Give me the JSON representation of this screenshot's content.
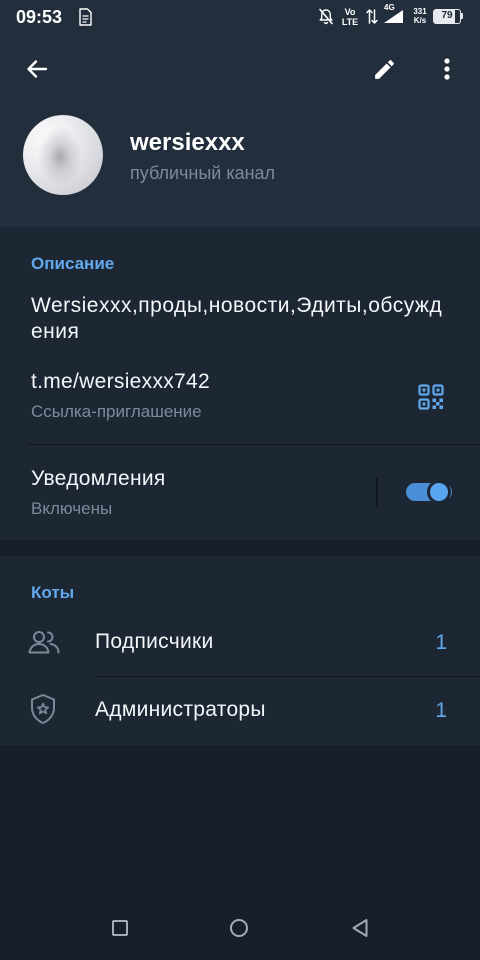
{
  "status_bar": {
    "time": "09:53",
    "volte_top": "Vo",
    "volte_bottom": "LTE",
    "network_type": "4G",
    "speed_value": "331",
    "speed_unit": "K/s",
    "battery_percent": "79"
  },
  "channel": {
    "name": "wersiexxx",
    "type": "публичный канал"
  },
  "info": {
    "description_title": "Описание",
    "description": "Wersiexxx,проды,новости,Эдиты,обсуждения",
    "link": "t.me/wersiexxx742",
    "link_caption": "Ссылка-приглашение",
    "notifications_label": "Уведомления",
    "notifications_status": "Включены",
    "notifications_enabled": true
  },
  "members": {
    "title": "Коты",
    "items": [
      {
        "label": "Подписчики",
        "count": "1",
        "icon": "users-icon"
      },
      {
        "label": "Администраторы",
        "count": "1",
        "icon": "shield-star-icon"
      }
    ]
  },
  "icons": {
    "back": "back-arrow-icon",
    "edit": "pencil-icon",
    "menu": "more-vertical-icon",
    "qr": "qr-code-icon",
    "nav": [
      "square-icon",
      "circle-icon",
      "triangle-back-icon"
    ]
  },
  "colors": {
    "header_bg": "#232e3c",
    "card_bg": "#1d2734",
    "page_bg": "#181f29",
    "accent": "#62a8ec",
    "text_primary": "#f4f6f9",
    "text_secondary": "#7e8a98",
    "toggle_track": "#4a8fd6"
  }
}
